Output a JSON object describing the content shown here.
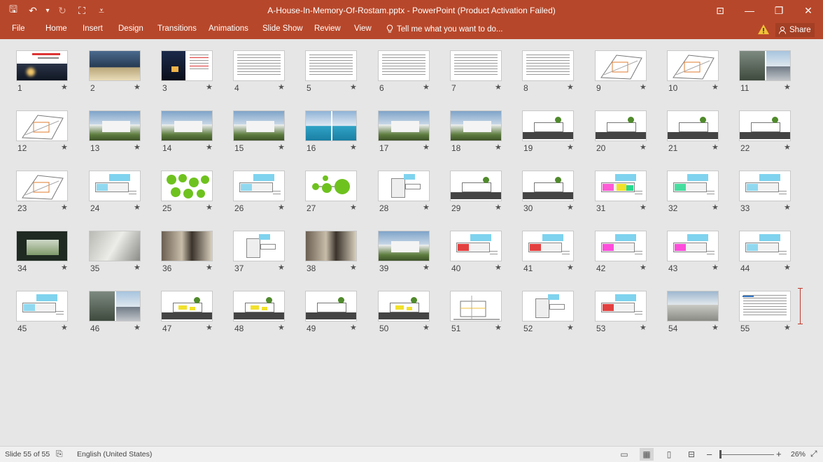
{
  "window": {
    "title": "A-House-In-Memory-Of-Rostam.pptx - PowerPoint (Product Activation Failed)",
    "accent": "#b7472a"
  },
  "quick_access": [
    {
      "name": "save-icon",
      "glyph": "🖫"
    },
    {
      "name": "undo-icon",
      "glyph": "↶"
    },
    {
      "name": "undo-dropdown-icon",
      "glyph": "▾"
    },
    {
      "name": "redo-icon",
      "glyph": "↻"
    },
    {
      "name": "start-from-beginning-icon",
      "glyph": "⛶"
    },
    {
      "name": "customize-qat-icon",
      "glyph": "⩡"
    }
  ],
  "window_controls": [
    {
      "name": "ribbon-display-options-icon",
      "glyph": "⊡"
    },
    {
      "name": "minimize-icon",
      "glyph": "—"
    },
    {
      "name": "restore-icon",
      "glyph": "❐"
    },
    {
      "name": "close-icon",
      "glyph": "✕"
    }
  ],
  "ribbon": {
    "tabs": [
      "File",
      "Home",
      "Insert",
      "Design",
      "Transitions",
      "Animations",
      "Slide Show",
      "Review",
      "View"
    ],
    "tell_me": "Tell me what you want to do...",
    "share": "Share"
  },
  "slides": {
    "count": 55,
    "current": 55,
    "star": "★",
    "kinds": [
      "title",
      "photo-night",
      "photo-text",
      "text",
      "text",
      "text",
      "text",
      "text",
      "plan-diagram",
      "plan-diagram",
      "photo-collage",
      "plan-diagram",
      "photo",
      "photo",
      "photo",
      "photo-pool",
      "photo",
      "photo",
      "elevation",
      "elevation",
      "elevation",
      "elevation",
      "plan-diagram",
      "plan-color",
      "green-circles",
      "plan-color",
      "green-bubbles",
      "plan",
      "elevation",
      "elevation",
      "plan-vivid",
      "plan-green",
      "plan-color",
      "photo-dark",
      "photo-grey",
      "photo-interior",
      "plan",
      "photo-interior",
      "photo",
      "plan-red",
      "plan-red",
      "plan-magenta",
      "plan-magenta",
      "plan-color",
      "plan-color",
      "photo-collage",
      "elevation-yellow",
      "elevation-yellow",
      "elevation",
      "elevation-yellow",
      "section",
      "plan",
      "plan-red",
      "photo-wall",
      "text-final"
    ]
  },
  "status": {
    "slide_label": "Slide 55 of 55",
    "language": "English (United States)",
    "zoom": "26%",
    "zoom_minus": "–",
    "zoom_plus": "+",
    "zoom_level": 0.26
  }
}
